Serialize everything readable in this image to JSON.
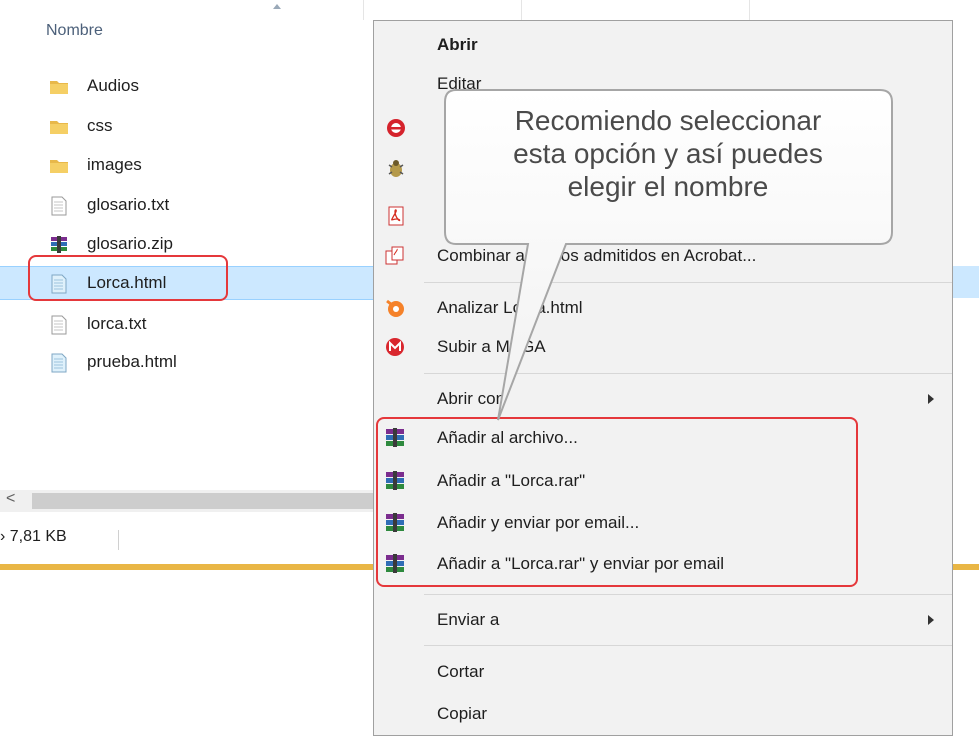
{
  "explorer": {
    "column_header": "Nombre",
    "files": [
      {
        "name": "Audios",
        "icon": "folder-icon"
      },
      {
        "name": "css",
        "icon": "folder-icon"
      },
      {
        "name": "images",
        "icon": "folder-icon"
      },
      {
        "name": "glosario.txt",
        "icon": "text-file-icon"
      },
      {
        "name": "glosario.zip",
        "icon": "winrar-archive-icon"
      },
      {
        "name": "Lorca.html",
        "icon": "html-file-icon",
        "selected": true
      },
      {
        "name": "lorca.txt",
        "icon": "text-file-icon"
      },
      {
        "name": "prueba.html",
        "icon": "html-file-icon"
      }
    ],
    "scroll_left_glyph": "<",
    "status_size": "› 7,81 KB"
  },
  "context_menu": {
    "items": [
      {
        "label": "Abrir",
        "bold": true
      },
      {
        "label": "Editar"
      },
      {
        "label": "Combinar archivos admitidos en Acrobat...",
        "icon": "acrobat-combine-icon"
      },
      {
        "label": "Analizar Lorca.html",
        "icon": "avast-icon"
      },
      {
        "label": "Subir a MEGA",
        "icon": "mega-icon"
      },
      {
        "label": "Abrir con",
        "submenu": true
      },
      {
        "label": "Añadir al archivo...",
        "icon": "winrar-icon"
      },
      {
        "label": "Añadir a \"Lorca.rar\"",
        "icon": "winrar-icon"
      },
      {
        "label": "Añadir y enviar por email...",
        "icon": "winrar-icon"
      },
      {
        "label": "Añadir a \"Lorca.rar\" y enviar por email",
        "icon": "winrar-icon"
      },
      {
        "label": "Enviar a",
        "submenu": true
      },
      {
        "label": "Cortar"
      },
      {
        "label": "Copiar"
      }
    ]
  },
  "callout": {
    "lines": [
      "Recomiendo seleccionar",
      "esta opción y así puedes",
      "elegir el nombre"
    ]
  },
  "colors": {
    "highlight": "#e5383b",
    "selection": "#cce8ff",
    "status_strip": "#e9b645"
  }
}
